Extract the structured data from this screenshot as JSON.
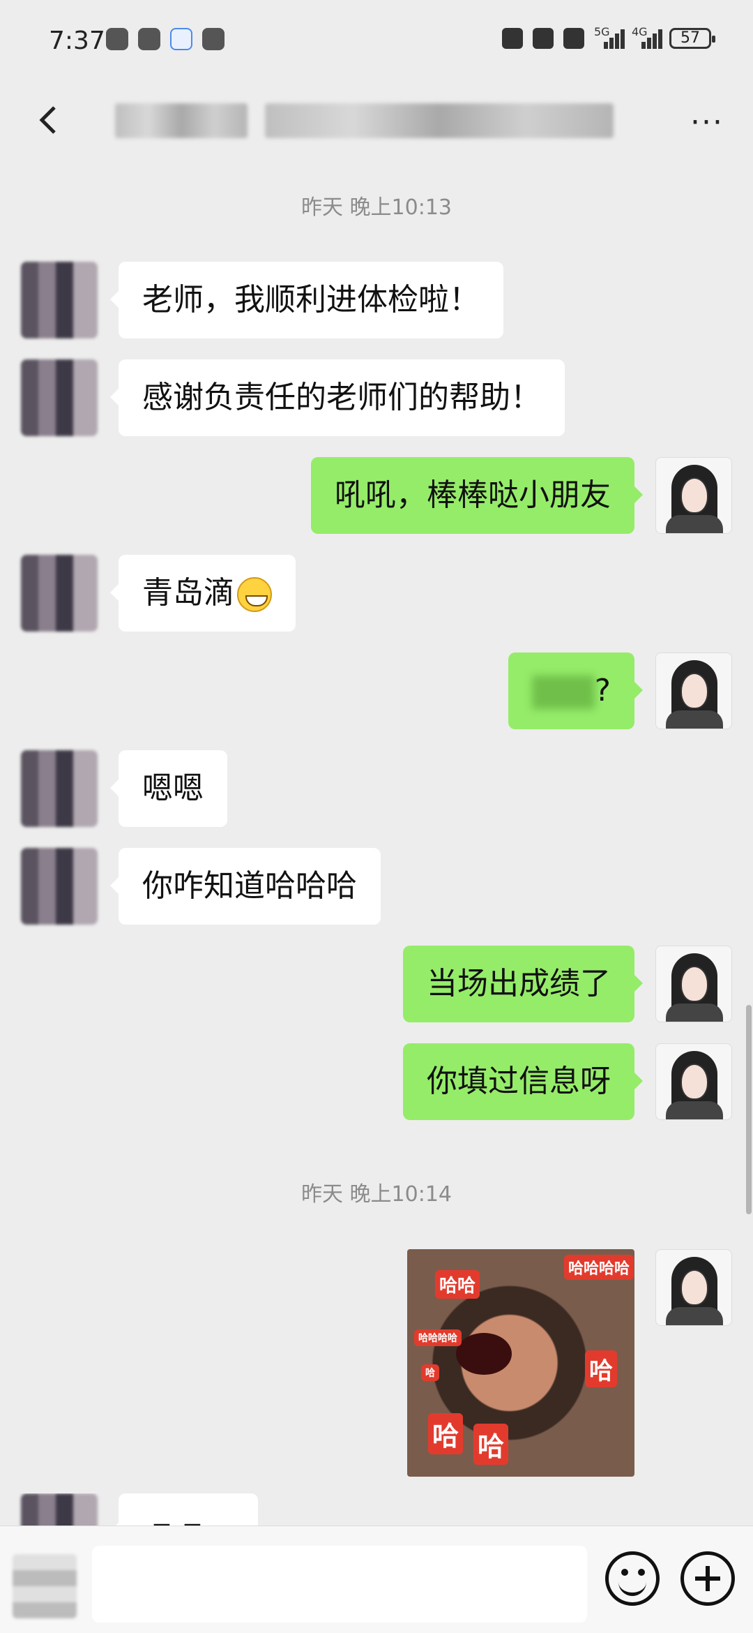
{
  "status_bar": {
    "time": "7:37",
    "network_1": "5G",
    "network_2": "4G",
    "battery": "57"
  },
  "chat": {
    "timestamps": [
      "昨天 晚上10:13",
      "昨天 晚上10:14"
    ],
    "messages": [
      {
        "from": "peer",
        "text": "老师，我顺利进体检啦！"
      },
      {
        "from": "peer",
        "text": "感谢负责任的老师们的帮助！"
      },
      {
        "from": "me",
        "text": "吼吼，棒棒哒小朋友"
      },
      {
        "from": "peer",
        "text": "青岛滴",
        "emoji": "grinning-face"
      },
      {
        "from": "me",
        "text": "?"
      },
      {
        "from": "peer",
        "text": "嗯嗯"
      },
      {
        "from": "peer",
        "text": "你咋知道哈哈哈"
      },
      {
        "from": "me",
        "text": "当场出成绩了"
      },
      {
        "from": "me",
        "text": "你填过信息呀"
      }
    ],
    "sticker": {
      "labels": [
        "哈哈",
        "哈哈哈哈",
        "哈哈哈哈",
        "哈",
        "哈",
        "哈",
        "哈"
      ]
    },
    "last_peer_partial": "嗯嗯！"
  },
  "input": {
    "placeholder": ""
  },
  "icons": {
    "back": "back-arrow-icon",
    "more": "more-icon",
    "emoji": "emoji-icon",
    "add": "plus-icon"
  }
}
